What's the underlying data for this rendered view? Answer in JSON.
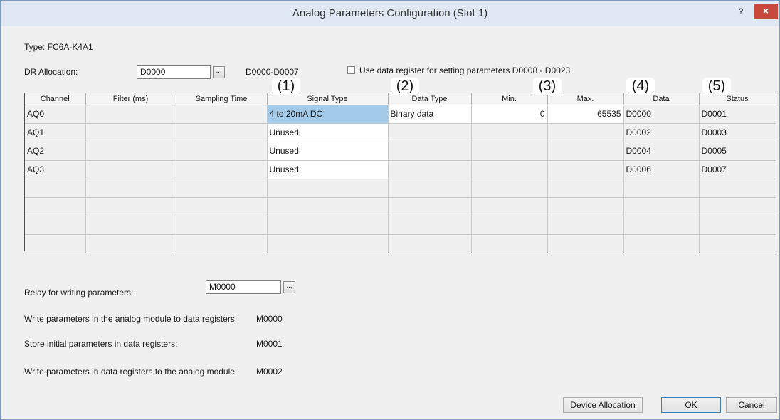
{
  "window": {
    "title": "Analog Parameters Configuration (Slot 1)",
    "help_label": "?",
    "close_label": "×"
  },
  "type_label": "Type: FC6A-K4A1",
  "dr": {
    "label": "DR Allocation:",
    "value": "D0000",
    "range": "D0000-D0007",
    "button": "..."
  },
  "use_register": {
    "label": "Use data register for setting parameters D0008 - D0023",
    "checked": false
  },
  "markers": [
    "(1)",
    "(2)",
    "(3)",
    "(4)",
    "(5)"
  ],
  "table": {
    "headers": [
      "Channel",
      "Filter (ms)",
      "Sampling Time",
      "Signal Type",
      "Data Type",
      "Min.",
      "Max.",
      "Data",
      "Status"
    ],
    "rows": [
      {
        "channel": "AQ0",
        "filter": "",
        "sampling": "",
        "signal": "4 to 20mA DC",
        "datatype": "Binary data",
        "min": "0",
        "max": "65535",
        "data": "D0000",
        "status": "D0001"
      },
      {
        "channel": "AQ1",
        "filter": "",
        "sampling": "",
        "signal": "Unused",
        "datatype": "",
        "min": "",
        "max": "",
        "data": "D0002",
        "status": "D0003"
      },
      {
        "channel": "AQ2",
        "filter": "",
        "sampling": "",
        "signal": "Unused",
        "datatype": "",
        "min": "",
        "max": "",
        "data": "D0004",
        "status": "D0005"
      },
      {
        "channel": "AQ3",
        "filter": "",
        "sampling": "",
        "signal": "Unused",
        "datatype": "",
        "min": "",
        "max": "",
        "data": "D0006",
        "status": "D0007"
      }
    ]
  },
  "relay": {
    "label": "Relay for writing parameters:",
    "value": "M0000",
    "button": "..."
  },
  "info": [
    {
      "label": "Write parameters in the analog module to data registers:",
      "value": "M0000"
    },
    {
      "label": "Store initial parameters in data registers:",
      "value": "M0001"
    },
    {
      "label": "Write parameters in data registers to the analog module:",
      "value": "M0002"
    }
  ],
  "buttons": {
    "device_allocation": "Device Allocation",
    "ok": "OK",
    "cancel": "Cancel"
  }
}
